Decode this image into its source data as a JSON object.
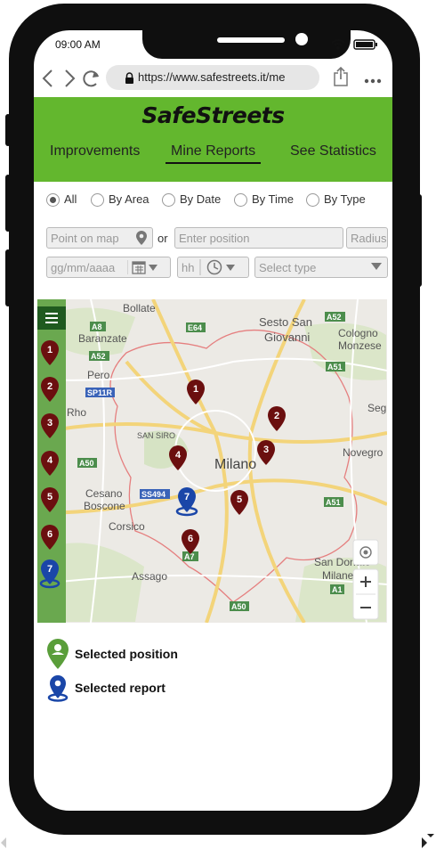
{
  "status": {
    "time": "09:00 AM"
  },
  "browser": {
    "url": "https://www.safestreets.it/me"
  },
  "app": {
    "title": "SafeStreets",
    "tabs": [
      {
        "label": "Improvements",
        "active": false
      },
      {
        "label": "Mine Reports",
        "active": true
      },
      {
        "label": "See Statistics",
        "active": false
      }
    ],
    "brand_color": "#63b72e"
  },
  "filters": {
    "options": [
      {
        "label": "All",
        "selected": true
      },
      {
        "label": "By Area",
        "selected": false
      },
      {
        "label": "By Date",
        "selected": false
      },
      {
        "label": "By Time",
        "selected": false
      },
      {
        "label": "By Type",
        "selected": false
      }
    ],
    "point_placeholder": "Point on map",
    "or_label": "or",
    "position_placeholder": "Enter position",
    "radius_placeholder": "Radius",
    "date_placeholder": "gg/mm/aaaa",
    "hour_placeholder": "hh",
    "type_placeholder": "Select type"
  },
  "map": {
    "labels": [
      "Bollate",
      "Sesto San",
      "Giovanni",
      "Baranzate",
      "Cologno",
      "Monzese",
      "Pero",
      "Milano",
      "SAN SIRO",
      "Novegro",
      "Segrate",
      "Cesano",
      "Boscone",
      "Corsico",
      "Assago",
      "San Donato",
      "Milanese",
      "Rho"
    ],
    "road_shields": [
      "A8",
      "E64",
      "A52",
      "A52",
      "SP11R",
      "A51",
      "A50",
      "SS494",
      "A51",
      "A7",
      "A1",
      "A50"
    ],
    "report_pins": [
      "1",
      "2",
      "3",
      "4",
      "5",
      "6"
    ],
    "selected_report": "7",
    "rail_pins": [
      "1",
      "2",
      "3",
      "4",
      "5",
      "6",
      "7"
    ]
  },
  "legend": {
    "position_label": "Selected position",
    "report_label": "Selected report"
  }
}
